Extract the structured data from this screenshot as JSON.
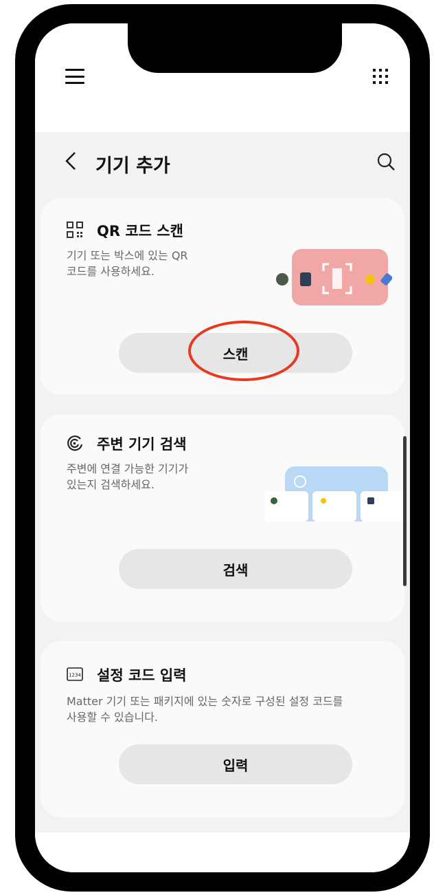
{
  "header": {
    "title": "기기 추가"
  },
  "cards": {
    "qr": {
      "title": "QR 코드 스캔",
      "description": "기기 또는 박스에 있는 QR\n코드를 사용하세요.",
      "button_label": "스캔"
    },
    "nearby": {
      "title": "주변 기기 검색",
      "description": "주변에 연결 가능한 기기가\n있는지 검색하세요.",
      "button_label": "검색"
    },
    "setup_code": {
      "title": "설정 코드 입력",
      "description": "Matter 기기 또는 패키지에 있는 숫자로 구성된 설정 코드를\n사용할 수 있습니다.",
      "button_label": "입력",
      "icon_text": "1234"
    }
  },
  "colors": {
    "highlight": "#e53a22",
    "qr_illustration_bg": "#f2a7a7",
    "nearby_illustration_bg": "#b9d8f5"
  }
}
